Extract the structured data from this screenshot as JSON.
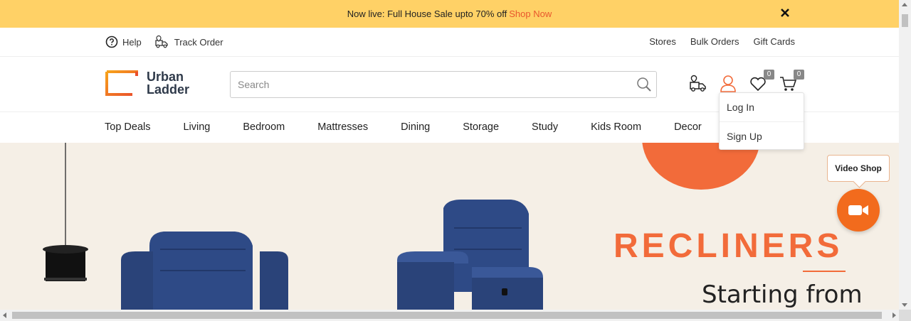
{
  "promo": {
    "text": "Now live: Full House Sale upto 70% off",
    "link": "Shop Now"
  },
  "utility": {
    "help": "Help",
    "track_order": "Track Order",
    "right": [
      "Stores",
      "Bulk Orders",
      "Gift Cards"
    ]
  },
  "header": {
    "logo_line1": "Urban",
    "logo_line2": "Ladder",
    "search_placeholder": "Search",
    "wishlist_count": "0",
    "cart_count": "0"
  },
  "nav": [
    "Top Deals",
    "Living",
    "Bedroom",
    "Mattresses",
    "Dining",
    "Storage",
    "Study",
    "Kids Room",
    "Decor"
  ],
  "account_menu": [
    "Log In",
    "Sign Up"
  ],
  "hero": {
    "title": "RECLINERS",
    "subtitle": "Starting from"
  },
  "video_shop": {
    "label": "Video Shop"
  },
  "colors": {
    "accent": "#f26b3a",
    "promo_bg": "#ffd166",
    "hero_bg": "#f5efe6",
    "recliner": "#2e4a86"
  }
}
